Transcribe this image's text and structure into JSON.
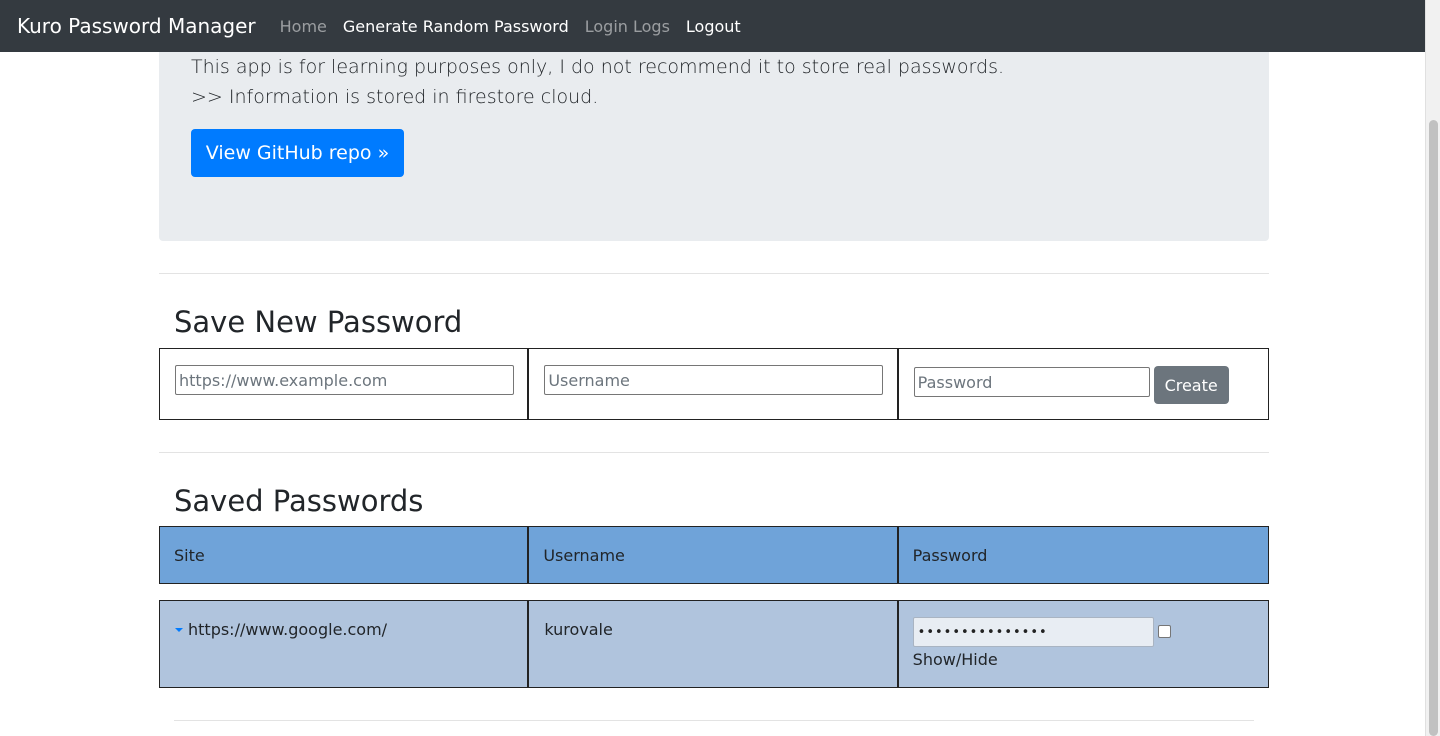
{
  "navbar": {
    "brand": "Kuro Password Manager",
    "links": [
      {
        "label": "Home",
        "active": false
      },
      {
        "label": "Generate Random Password",
        "active": true
      },
      {
        "label": "Login Logs",
        "active": false
      },
      {
        "label": "Logout",
        "active": true
      }
    ]
  },
  "jumbotron": {
    "line1": "This app is for learning purposes only, I do not recommend it to store real passwords.",
    "line2": ">> Information is stored in firestore cloud.",
    "button_label": "View GitHub repo »"
  },
  "save_form": {
    "heading": "Save New Password",
    "site_placeholder": "https://www.example.com",
    "username_placeholder": "Username",
    "password_placeholder": "Password",
    "create_label": "Create"
  },
  "saved": {
    "heading": "Saved Passwords",
    "columns": [
      "Site",
      "Username",
      "Password"
    ],
    "rows": [
      {
        "site": "https://www.google.com/",
        "username": "kurovale",
        "password_masked": "•••••••••••••••",
        "toggle_label": "Show/Hide"
      }
    ]
  },
  "colors": {
    "navbar_bg": "#343a40",
    "primary": "#007bff",
    "secondary": "#6c757d",
    "table_header_bg": "#6fa3d9",
    "table_row_bg": "#b0c4dd",
    "jumbotron_bg": "#e9ecef"
  }
}
